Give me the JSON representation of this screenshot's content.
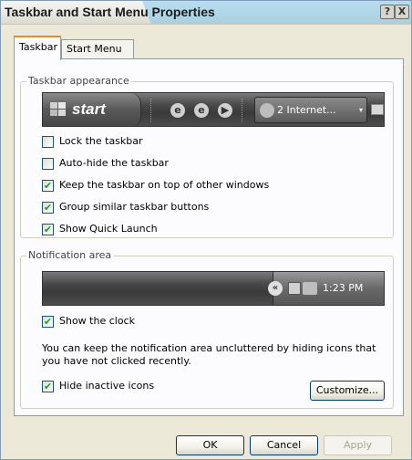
{
  "window": {
    "title": "Taskbar and Start Menu Properties",
    "help_glyph": "?",
    "close_glyph": "X"
  },
  "tabs": [
    {
      "label": "Taskbar",
      "active": true
    },
    {
      "label": "Start Menu",
      "active": false
    }
  ],
  "taskbar_appearance": {
    "group_label": "Taskbar appearance",
    "preview": {
      "start_label": "start",
      "quick_launch_glyphs": [
        "e",
        "e",
        "▶"
      ],
      "task_button_label": "2 Internet...",
      "task_button_arrow": "▾"
    },
    "options": [
      {
        "label": "Lock the taskbar",
        "checked": false
      },
      {
        "label": "Auto-hide the taskbar",
        "checked": false
      },
      {
        "label": "Keep the taskbar on top of other windows",
        "checked": true
      },
      {
        "label": "Group similar taskbar buttons",
        "checked": true
      },
      {
        "label": "Show Quick Launch",
        "checked": true
      }
    ]
  },
  "notification_area": {
    "group_label": "Notification area",
    "preview": {
      "chevron_glyph": "«",
      "clock": "1:23 PM"
    },
    "show_clock": {
      "label": "Show the clock",
      "checked": true
    },
    "info_text": "You can keep the notification area uncluttered by hiding icons that you have not clicked recently.",
    "hide_inactive": {
      "label": "Hide inactive icons",
      "checked": true
    },
    "customize_label": "Customize..."
  },
  "footer": {
    "ok_label": "OK",
    "cancel_label": "Cancel",
    "apply_label": "Apply",
    "apply_enabled": false
  },
  "check_glyph": "✔",
  "colors": {
    "dialog_face": "#ece9d8",
    "active_tab_accent": "#e68b2c",
    "checkmark": "#21a121"
  }
}
